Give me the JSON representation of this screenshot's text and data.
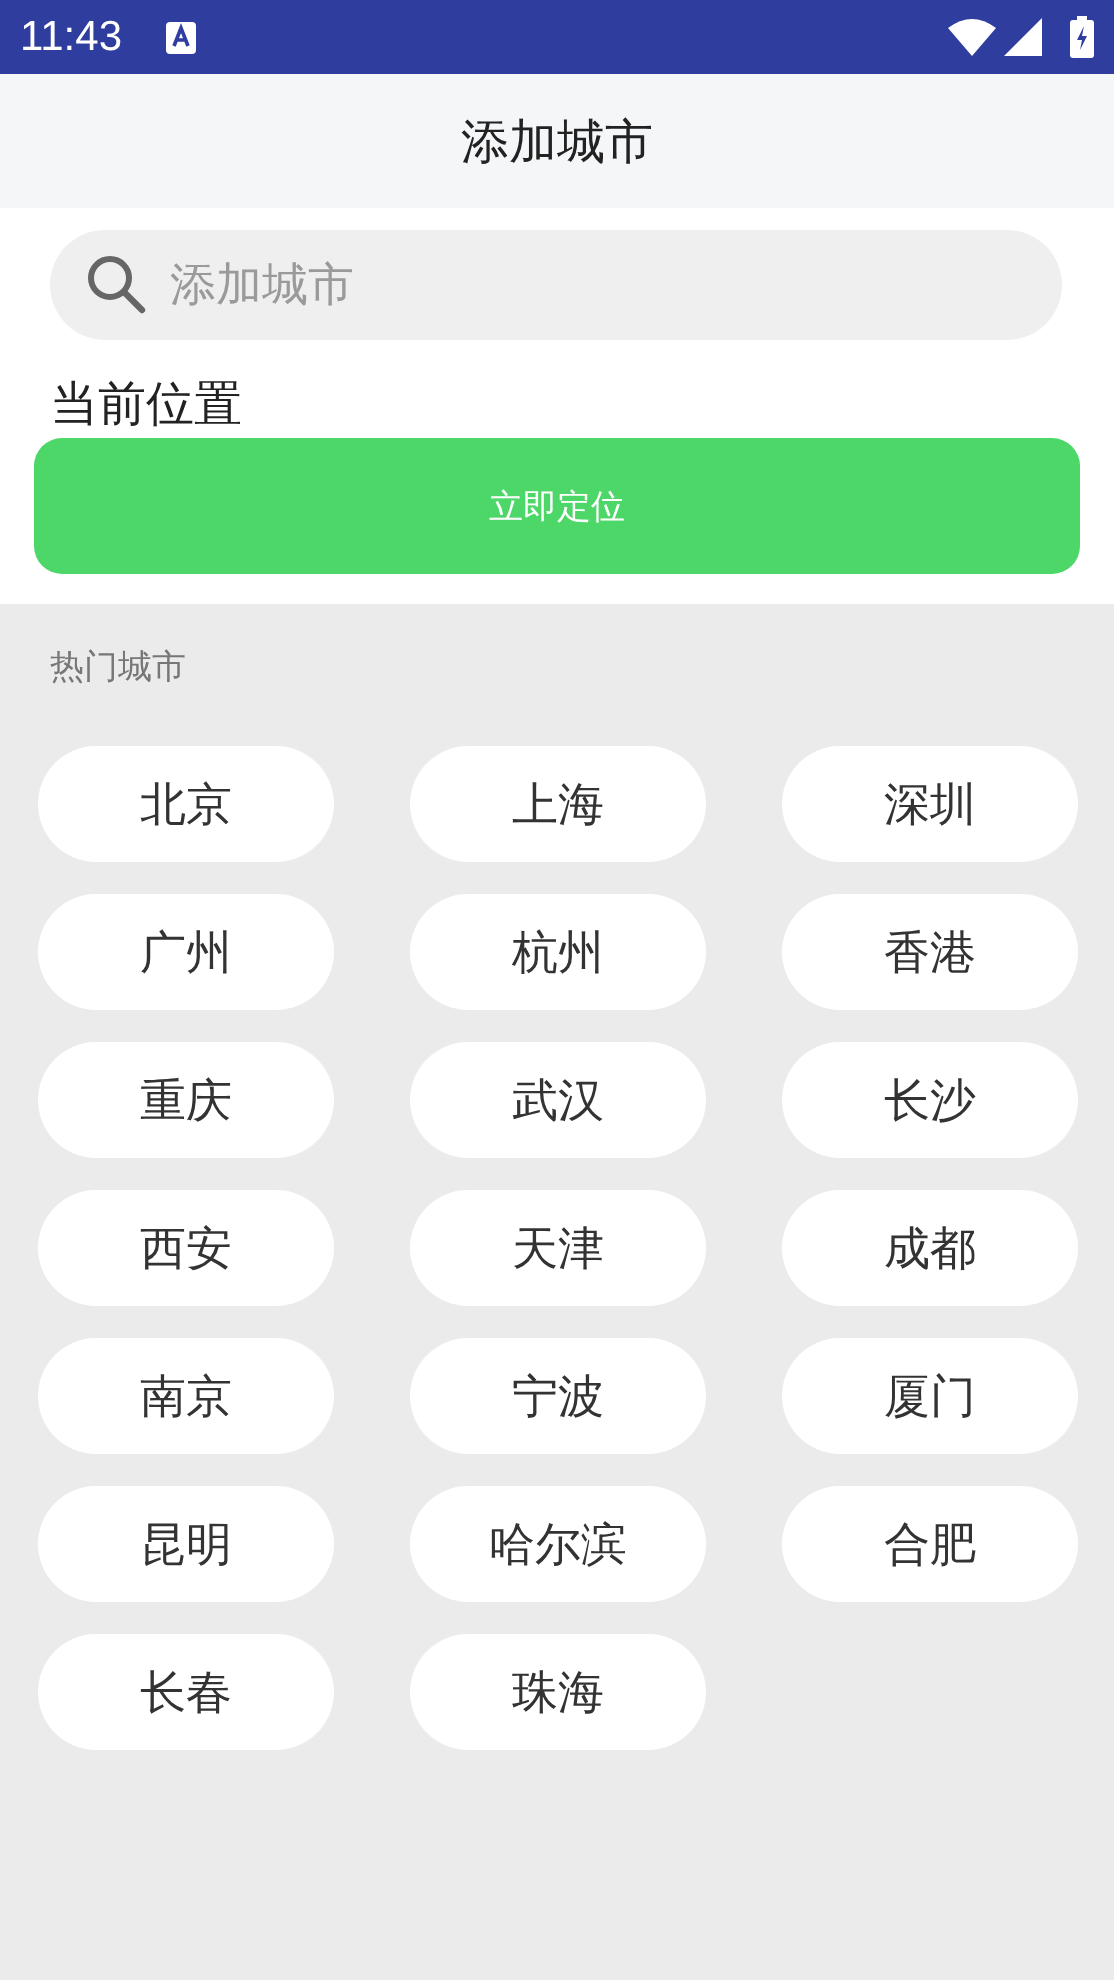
{
  "status_bar": {
    "time": "11:43"
  },
  "header": {
    "title": "添加城市"
  },
  "search": {
    "placeholder": "添加城市"
  },
  "current_location": {
    "label": "当前位置",
    "button": "立即定位"
  },
  "hot_cities": {
    "title": "热门城市",
    "cities": [
      "北京",
      "上海",
      "深圳",
      "广州",
      "杭州",
      "香港",
      "重庆",
      "武汉",
      "长沙",
      "西安",
      "天津",
      "成都",
      "南京",
      "宁波",
      "厦门",
      "昆明",
      "哈尔滨",
      "合肥",
      "长春",
      "珠海"
    ]
  }
}
